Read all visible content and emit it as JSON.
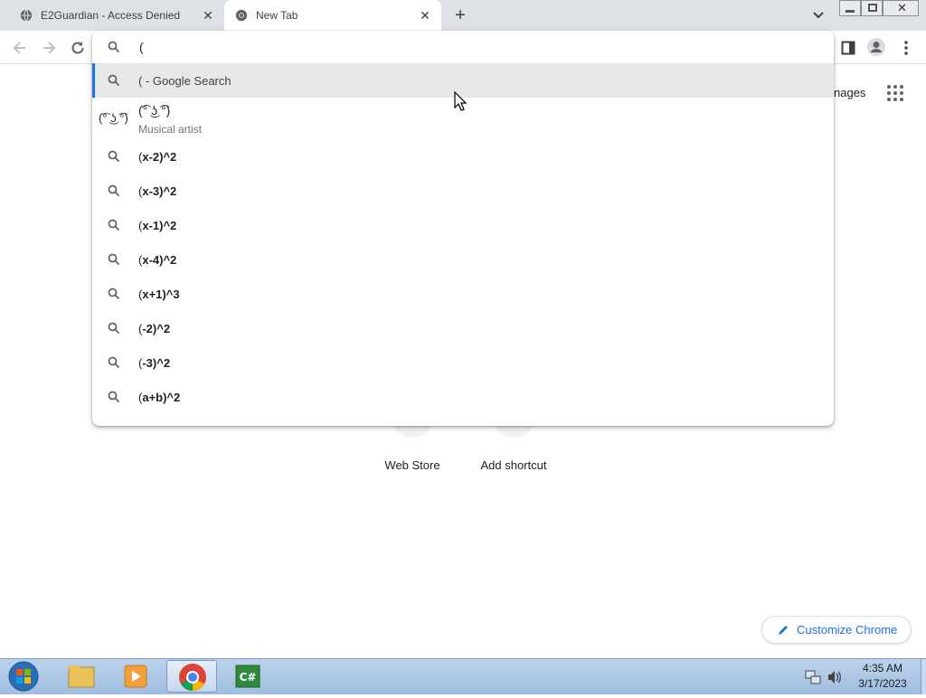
{
  "tabs": [
    {
      "title": "E2Guardian - Access Denied",
      "active": false
    },
    {
      "title": "New Tab",
      "active": true
    }
  ],
  "omnibox": {
    "query": "(",
    "suggestions": [
      {
        "text": "( - Google Search",
        "bold": "",
        "icon": "search-icon",
        "selected": true
      },
      {
        "text": "(͡° ͜ʖ ͡°)",
        "sub": "Musical artist",
        "icon": "entity-thumbnail"
      },
      {
        "text": "(",
        "bold": "x-2)^2",
        "icon": "search-icon"
      },
      {
        "text": "(",
        "bold": "x-3)^2",
        "icon": "search-icon"
      },
      {
        "text": "(",
        "bold": "x-1)^2",
        "icon": "search-icon"
      },
      {
        "text": "(",
        "bold": "x-4)^2",
        "icon": "search-icon"
      },
      {
        "text": "(",
        "bold": "x+1)^3",
        "icon": "search-icon"
      },
      {
        "text": "(",
        "bold": "-2)^2",
        "icon": "search-icon"
      },
      {
        "text": "(",
        "bold": "-3)^2",
        "icon": "search-icon"
      },
      {
        "text": "(",
        "bold": "a+b)^2",
        "icon": "search-icon"
      }
    ]
  },
  "header": {
    "images_partial": "nages"
  },
  "shortcuts": [
    {
      "label": "Web Store"
    },
    {
      "label": "Add shortcut"
    }
  ],
  "customize_label": "Customize Chrome",
  "taskbar": {
    "time": "4:35 AM",
    "date": "3/17/2023"
  },
  "colors": {
    "accent": "#1a73e8",
    "tabstrip": "#dee1e6"
  }
}
